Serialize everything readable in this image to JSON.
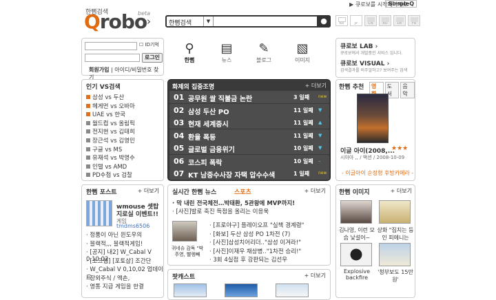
{
  "topbar": {
    "start_link": "▶ 큐로보를 시작페이지로",
    "simpleq": "SimpleQ"
  },
  "logo": {
    "small": "한뻠검색",
    "q": "Q",
    "rest": "robo",
    "beta": "beta",
    "arrow": "›"
  },
  "search": {
    "category": "한뻠검색",
    "placeholder": ""
  },
  "flags": [
    "KR",
    "JP",
    "CN",
    "RU",
    "DE",
    "FR"
  ],
  "login": {
    "remember_label": "ID기억",
    "login_button": "로그인",
    "join": "회원가입",
    "find": "아이디/비밀번호 찾기"
  },
  "nav": [
    {
      "label": "한뻠",
      "icon": "search-icon",
      "active": true
    },
    {
      "label": "뉴스",
      "icon": "newspaper-icon",
      "active": false
    },
    {
      "label": "블로그",
      "icon": "blog-icon",
      "active": false
    },
    {
      "label": "이미지",
      "icon": "image-icon",
      "active": false
    }
  ],
  "lab": {
    "lab_title": "큐로보 LAB ›",
    "lab_desc": "큐로보에서 개발중인 서비스 입니다.",
    "visual_title": "큐로보 VISUAL ›",
    "visual_desc": "검색결과를 비주얼하고? 보여주는 검색"
  },
  "vs": {
    "title": "인기 VS검색",
    "items": [
      {
        "text": "삼성 vs 두산",
        "dark": false
      },
      {
        "text": "헤게먼 vs 오바마",
        "dark": false
      },
      {
        "text": "UAE vs 한국",
        "dark": false
      },
      {
        "text": "월드컵 vs 올림픽",
        "dark": true
      },
      {
        "text": "전지현 vs 김태희",
        "dark": true
      },
      {
        "text": "장근석 vs 김영민",
        "dark": true
      },
      {
        "text": "구글 vs MS",
        "dark": true
      },
      {
        "text": "유재석 vs 박명수",
        "dark": true
      },
      {
        "text": "인텔 vs AMD",
        "dark": true
      },
      {
        "text": "PD수첩 vs 검찰",
        "dark": true
      }
    ]
  },
  "hot": {
    "title": "화제의 집중조명",
    "more": "+ 더보기",
    "rows": [
      {
        "rank": "01",
        "text": "공무원 쌀 직불금 논란",
        "days": "3 일째",
        "badge": "new",
        "up": false
      },
      {
        "rank": "02",
        "text": "삼성 두산 PO",
        "days": "11 일째",
        "badge": "▼",
        "up": true
      },
      {
        "rank": "03",
        "text": "현재 세계증시",
        "days": "11 일째",
        "badge": "▲",
        "up": true
      },
      {
        "rank": "04",
        "text": "환율 폭등",
        "days": "11 일째",
        "badge": "▼",
        "up": true
      },
      {
        "rank": "05",
        "text": "글로벌 금융위기",
        "days": "10 일째",
        "badge": "▼",
        "up": true
      },
      {
        "rank": "06",
        "text": "코스피 폭락",
        "days": "10 일째",
        "badge": "–",
        "up": true
      },
      {
        "rank": "07",
        "text": "KT 남중수사장  자택 압수수색",
        "days": "1 일째",
        "badge": "new",
        "up": false
      }
    ]
  },
  "recommend": {
    "title": "한뻠 추천",
    "tabs": [
      "영화",
      "도서",
      "음악"
    ],
    "name": "이글 아이(2008,...",
    "stars": "★★★",
    "meta": "시아아 ,, / 액션 / 2008-10-09",
    "note": "- 이글아이 순정형 후방카메라 -"
  },
  "post": {
    "title": "한뻠 포스트",
    "more": "+ 더보기",
    "head1": "wmouse 셋탑",
    "head2": "지로실 이벤트!!",
    "sub": "게임",
    "author": "tmdms6506",
    "items": [
      "· 정품이 아닌 윈도우의",
      "· 블랙적,,, 블랙적게임!",
      "· [공지] 내2] W_Cabal V 0,10,02",
      "· [소크랩] [포토샵] 조간단",
      "· W_Cabal V 0,10,02 업데이트",
      "· 장외주식 / 액손,",
      "· 영통 지급 게임을 한결"
    ]
  },
  "news": {
    "tab1": "실시간 한뻠 뉴스",
    "tab2": "스포츠",
    "more": "+ 더보기",
    "headline": "· 막 내린 전국체전…박태환, 5관왕에 MVP까지!",
    "line2": "· [사진]발로 축진 득점을 올리는 이응욱",
    "caption": "귀네슈 감독 \"박주영, 빨렝빼",
    "list": [
      "· [프로야구] 플레이오프 \"실책 경계령\"",
      "· [화보] 두산 삼성 PO 1차전 (7)",
      "· [사진]삼성치어리더..\"삼성 이겨라!\"",
      "· [사진]이재우 채상병..\"1차전 승리!\"",
      "· 3회 4실점 후 강판되는 김선우"
    ]
  },
  "podcast": {
    "title": "팟캐스트",
    "more": "+ 더보기"
  },
  "images": {
    "title": "한뻠 이미지",
    "more": "+ 더보기",
    "captions": [
      "김나영, 이런 모습 낯설어~",
      "상화 \"집치는 등인 피에니는",
      "Explosive backfire",
      "'청부보도 15만원'"
    ]
  },
  "colors": {
    "accent": "#e06b10",
    "dark_panel": "#3a3a3a",
    "border": "#cccccc"
  }
}
